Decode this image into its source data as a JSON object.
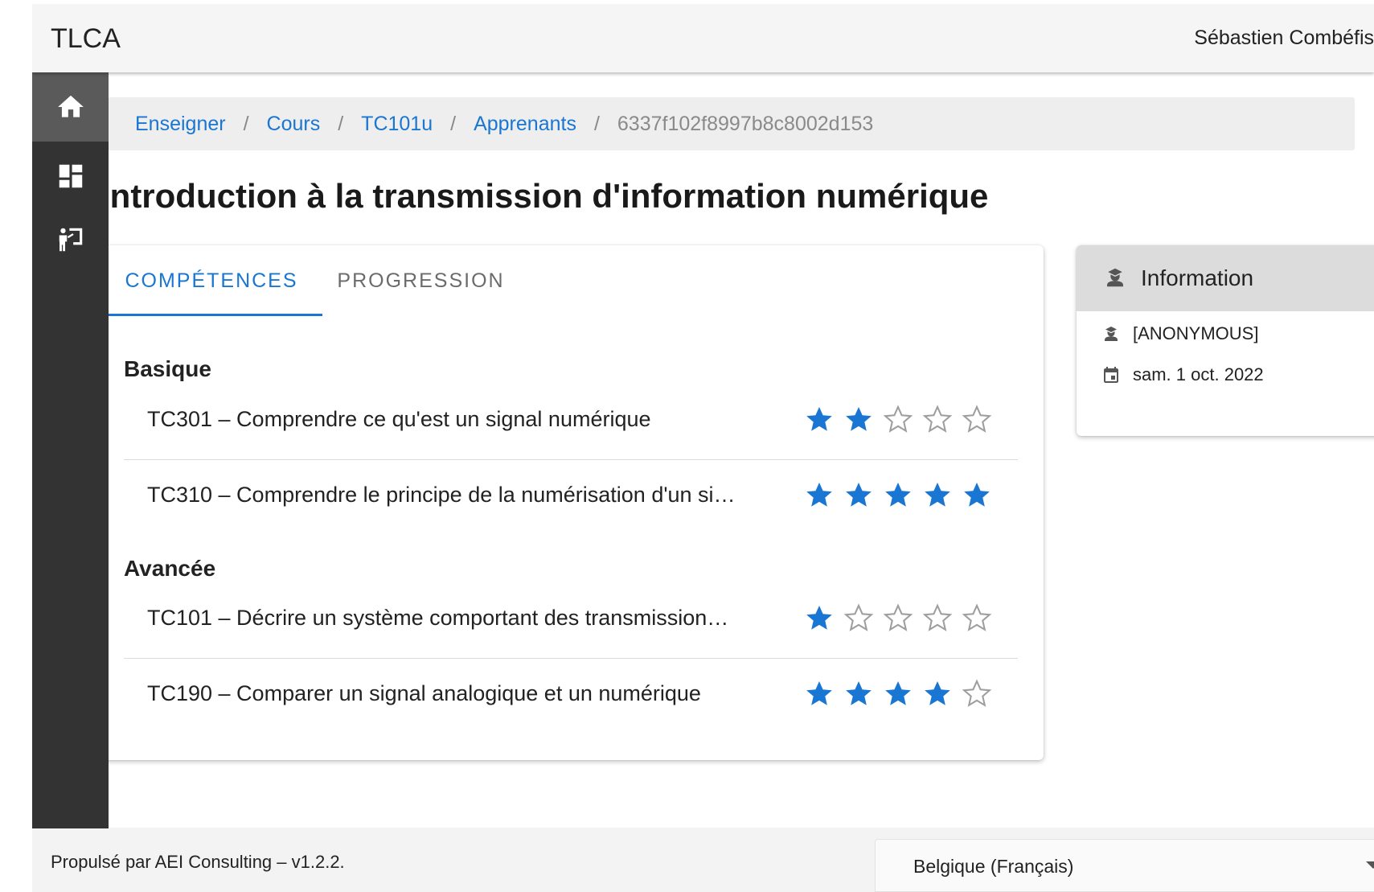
{
  "app": {
    "title": "TLCA",
    "user_name": "Sébastien Combéfis"
  },
  "sidebar": {
    "items": [
      {
        "icon": "home-icon",
        "active": true
      },
      {
        "icon": "dashboard-icon",
        "active": false
      },
      {
        "icon": "teacher-icon",
        "active": false
      }
    ]
  },
  "breadcrumb": {
    "items": [
      "Enseigner",
      "Cours",
      "TC101u",
      "Apprenants"
    ],
    "separator": "/",
    "current": "6337f102f8997b8c8002d153"
  },
  "page": {
    "title": "Introduction à la transmission d'information numérique"
  },
  "tabs": [
    {
      "label": "COMPÉTENCES",
      "active": true
    },
    {
      "label": "PROGRESSION",
      "active": false
    }
  ],
  "competences": {
    "sections": [
      {
        "title": "Basique",
        "items": [
          {
            "label": "TC301 – Comprendre ce qu'est un signal numérique",
            "rating": 2,
            "max": 5
          },
          {
            "label": "TC310 – Comprendre le principe de la numérisation d'un si…",
            "rating": 5,
            "max": 5
          }
        ]
      },
      {
        "title": "Avancée",
        "items": [
          {
            "label": "TC101 – Décrire un système comportant des transmission…",
            "rating": 1,
            "max": 5
          },
          {
            "label": "TC190 – Comparer un signal analogique et un numérique",
            "rating": 4,
            "max": 5
          }
        ]
      }
    ]
  },
  "info": {
    "title": "Information",
    "learner": "[ANONYMOUS]",
    "date": "sam. 1 oct. 2022"
  },
  "footer": {
    "text": "Propulsé par AEI Consulting – v1.2.2.",
    "language": "Belgique (Français)"
  },
  "colors": {
    "accent": "#1976d2",
    "sidebar": "#333333",
    "empty_star": "#9e9e9e"
  }
}
